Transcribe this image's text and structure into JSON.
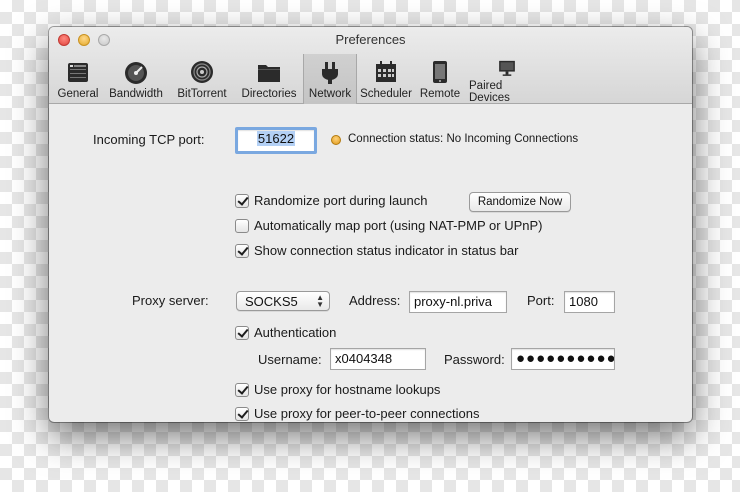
{
  "window": {
    "title": "Preferences"
  },
  "toolbar": {
    "items": [
      {
        "label": "General",
        "icon": "general-icon"
      },
      {
        "label": "Bandwidth",
        "icon": "gauge-icon"
      },
      {
        "label": "BitTorrent",
        "icon": "bittorrent-icon"
      },
      {
        "label": "Directories",
        "icon": "folder-icon"
      },
      {
        "label": "Network",
        "icon": "plug-icon",
        "selected": true
      },
      {
        "label": "Scheduler",
        "icon": "calendar-icon"
      },
      {
        "label": "Remote",
        "icon": "phone-icon"
      },
      {
        "label": "Paired Devices",
        "icon": "monitor-icon"
      }
    ]
  },
  "network": {
    "incoming_port_label": "Incoming TCP port:",
    "incoming_port_value": "51622",
    "connection_status": "Connection status: No Incoming Connections",
    "connection_status_color": "#e09a1a",
    "randomize_label": "Randomize port during launch",
    "randomize_checked": true,
    "randomize_now_label": "Randomize Now",
    "automap_label": "Automatically map port (using NAT-PMP or UPnP)",
    "automap_checked": false,
    "show_status_label": "Show connection status indicator in status bar",
    "show_status_checked": true,
    "proxy_server_label": "Proxy server:",
    "proxy_type": "SOCKS5",
    "address_label": "Address:",
    "address_value": "proxy-nl.priva",
    "port_label": "Port:",
    "port_value": "1080",
    "auth_label": "Authentication",
    "auth_checked": true,
    "username_label": "Username:",
    "username_value": "x0404348",
    "password_label": "Password:",
    "password_value": "●●●●●●●●●●",
    "hostname_label": "Use proxy for hostname lookups",
    "hostname_checked": true,
    "p2p_label": "Use proxy for peer-to-peer connections",
    "p2p_checked": true
  }
}
